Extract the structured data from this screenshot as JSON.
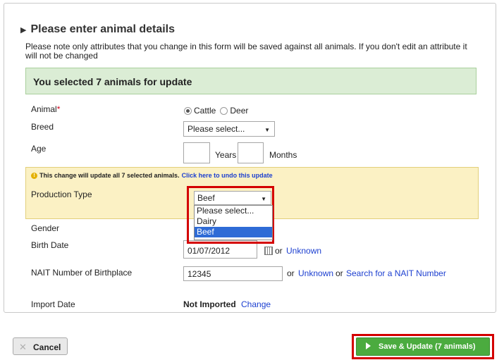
{
  "section": {
    "title": "Please enter animal details",
    "note": "Please note only attributes that you change in this form will be saved against all animals. If you don't edit an attribute it will not be changed"
  },
  "banner": {
    "text": "You selected 7 animals for update"
  },
  "fields": {
    "animal": {
      "label": "Animal",
      "required_mark": "*",
      "options": [
        "Cattle",
        "Deer"
      ],
      "selected": "Cattle"
    },
    "breed": {
      "label": "Breed",
      "value": "Please select..."
    },
    "age": {
      "label": "Age",
      "years_label": "Years",
      "months_label": "Months",
      "years_value": "",
      "months_value": ""
    },
    "production_type": {
      "warning": "This change will update all 7 selected animals.",
      "undo_link": "Click here to undo this update",
      "label": "Production Type",
      "value": "Beef",
      "options": [
        "Please select...",
        "Dairy",
        "Beef"
      ],
      "highlighted": "Beef"
    },
    "gender": {
      "label": "Gender"
    },
    "birth_date": {
      "label": "Birth Date",
      "value": "01/07/2012",
      "or": "or",
      "unknown_link": "Unknown"
    },
    "nait": {
      "label": "NAIT Number of Birthplace",
      "value": "12345",
      "or1": "or",
      "unknown_link": "Unknown",
      "or2": "or",
      "search_link": "Search for a NAIT Number"
    },
    "import_date": {
      "label": "Import Date",
      "value": "Not Imported",
      "change_link": "Change"
    }
  },
  "buttons": {
    "cancel": "Cancel",
    "save": "Save & Update (7 animals)"
  },
  "colors": {
    "banner_bg": "#dbedd5",
    "warning_bg": "#fbf1c4",
    "highlight_red": "#d40000",
    "save_green": "#4bab3f",
    "link_blue": "#1c3fd0"
  }
}
